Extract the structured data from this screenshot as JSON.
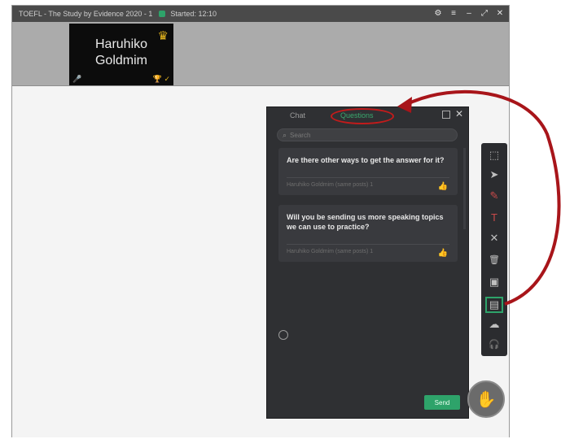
{
  "titlebar": {
    "title": "TOEFL - The Study by Evidence 2020 - 1",
    "started": "Started: 12:10",
    "controls": {
      "settings": "⚙",
      "menu": "≡",
      "minimize": "–",
      "maximize": "⤢",
      "close": "✕"
    }
  },
  "participant": {
    "name_line1": "Haruhiko",
    "name_line2": "Goldmim",
    "crown_icon": "♛",
    "mic_icon": "🎤",
    "status_icons": "🏆 ✓"
  },
  "panel": {
    "tab_chat": "Chat",
    "tab_questions": "Questions",
    "search_placeholder": "Search",
    "close_icon": "✕",
    "send_label": "Send",
    "questions": [
      {
        "text": "Are there other ways to get the answer for it?",
        "meta": "Haruhiko Goldmim (same posts) 1",
        "like_icon": "👍"
      },
      {
        "text": "Will you be sending us more speaking topics we can use to practice?",
        "meta": "Haruhiko Goldmim (same posts) 1",
        "like_icon": "👍"
      }
    ]
  },
  "toolbar": {
    "tools": [
      {
        "name": "select-area",
        "glyph": "⬚"
      },
      {
        "name": "pointer",
        "glyph": "➤"
      },
      {
        "name": "pen",
        "glyph": "✎"
      },
      {
        "name": "text",
        "glyph": "T"
      },
      {
        "name": "eraser",
        "glyph": "✕"
      },
      {
        "name": "delete",
        "glyph": "🗑"
      },
      {
        "name": "image",
        "glyph": "▣"
      },
      {
        "name": "chat-panel",
        "glyph": "▤"
      },
      {
        "name": "cloud",
        "glyph": "☁"
      },
      {
        "name": "headset",
        "glyph": "🎧"
      }
    ],
    "active_tool": "chat-panel",
    "accent_color": "#2ea36a"
  },
  "raise_hand_icon": "✋",
  "colors": {
    "annotation_red": "#c21b1b",
    "accent_green": "#2ea36a",
    "panel_bg": "#2f3033"
  }
}
